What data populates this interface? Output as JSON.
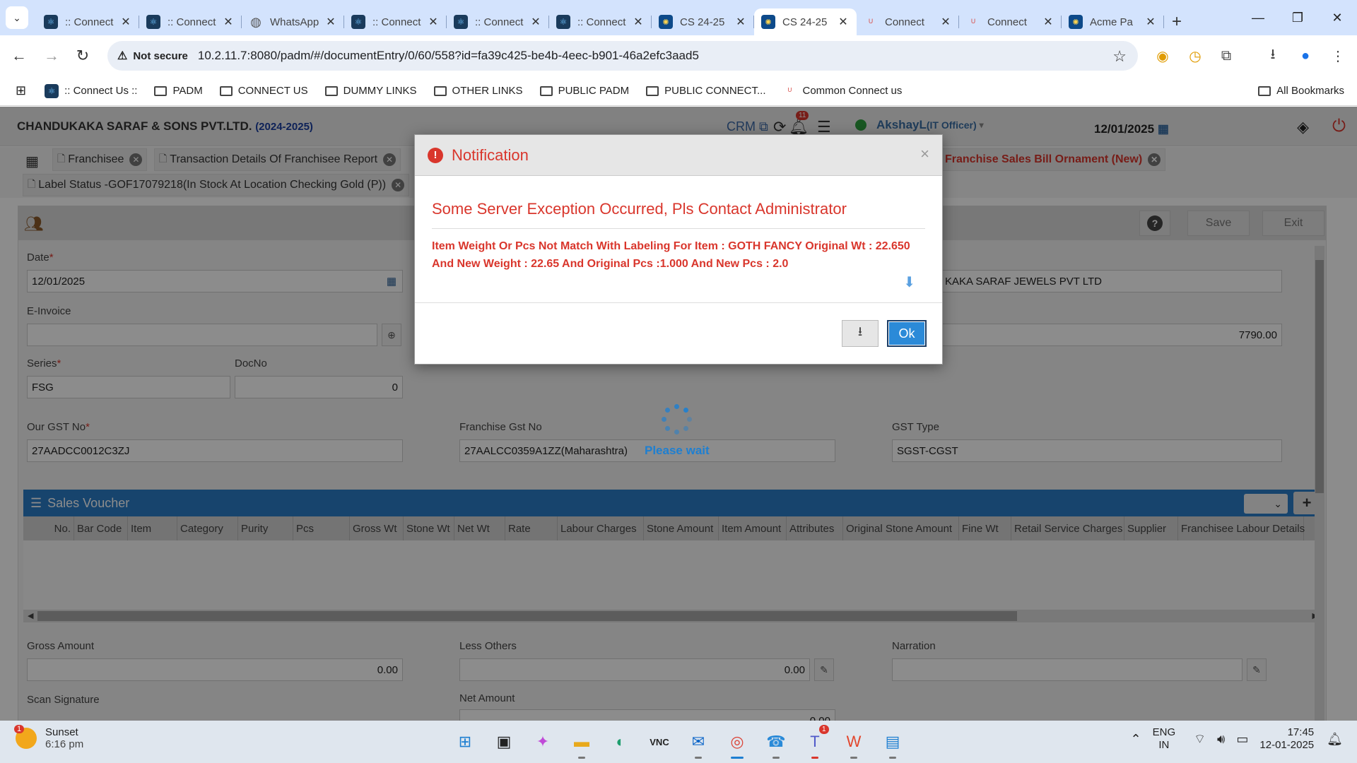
{
  "browser": {
    "tabs": [
      {
        "title": ":: Connect",
        "icon": "react-icon",
        "active": false
      },
      {
        "title": ":: Connect",
        "icon": "react-icon",
        "active": false
      },
      {
        "title": "WhatsApp",
        "icon": "globe-icon",
        "active": false
      },
      {
        "title": ":: Connect",
        "icon": "react-icon",
        "active": false
      },
      {
        "title": ":: Connect",
        "icon": "react-icon",
        "active": false
      },
      {
        "title": ":: Connect",
        "icon": "react-icon",
        "active": false
      },
      {
        "title": "CS 24-25",
        "icon": "cs-icon",
        "active": false
      },
      {
        "title": "CS 24-25",
        "icon": "cs-icon",
        "active": true
      },
      {
        "title": "Connect",
        "icon": "connect-icon",
        "active": false
      },
      {
        "title": "Connect",
        "icon": "connect-icon",
        "active": false
      },
      {
        "title": "Acme Pa",
        "icon": "cs-icon",
        "active": false
      }
    ],
    "security_label": "Not secure",
    "url": "10.2.11.7:8080/padm/#/documentEntry/0/60/558?id=fa39c425-be4b-4eec-b901-46a2efc3aad5",
    "bookmarks": [
      {
        "label": ":: Connect Us ::",
        "type": "site"
      },
      {
        "label": "PADM",
        "type": "folder"
      },
      {
        "label": "CONNECT US",
        "type": "folder"
      },
      {
        "label": "DUMMY LINKS",
        "type": "folder"
      },
      {
        "label": "OTHER LINKS",
        "type": "folder"
      },
      {
        "label": "PUBLIC PADM",
        "type": "folder"
      },
      {
        "label": "PUBLIC CONNECT...",
        "type": "folder"
      },
      {
        "label": "Common Connect us",
        "type": "site"
      }
    ],
    "all_bookmarks": "All Bookmarks"
  },
  "app": {
    "company": "CHANDUKAKA SARAF & SONS PVT.LTD.",
    "year": "(2024-2025)",
    "crm_label": "CRM",
    "notification_count": "11",
    "user_name": "AkshayL",
    "user_role": "(IT Officer)",
    "header_date": "12/01/2025",
    "subtabs": {
      "franchisee": "Franchisee",
      "transaction_report": "Transaction Details Of Franchisee Report",
      "sales_bill": "Franchise Sales Bill Ornament (New)",
      "label_status": "Label Status -GOF17079218(In Stock At Location Checking Gold (P))"
    },
    "buttons": {
      "save": "Save",
      "exit": "Exit"
    },
    "form": {
      "date_label": "Date",
      "date_value": "12/01/2025",
      "einvoice_label": "E-Invoice",
      "einvoice_value": "",
      "series_label": "Series",
      "series_value": "FSG",
      "docno_label": "DocNo",
      "docno_value": "0",
      "party_value": "KAKA SARAF JEWELS PVT LTD",
      "amount_value": "7790.00",
      "our_gst_label": "Our GST No",
      "our_gst_value": "27AADCC0012C3ZJ",
      "franchise_gst_label": "Franchise Gst No",
      "franchise_gst_value": "27AALCC0359A1ZZ(Maharashtra)",
      "gst_type_label": "GST Type",
      "gst_type_value": "SGST-CGST"
    },
    "voucher": {
      "title": "Sales Voucher",
      "columns": [
        "No.",
        "Bar Code",
        "Item",
        "Category",
        "Purity",
        "Pcs",
        "Gross Wt",
        "Stone Wt",
        "Net Wt",
        "Rate",
        "Labour Charges",
        "Stone Amount",
        "Item Amount",
        "Attributes",
        "Original Stone Amount",
        "Fine Wt",
        "Retail Service Charges",
        "Supplier",
        "Franchisee Labour Details"
      ]
    },
    "footer": {
      "gross_label": "Gross Amount",
      "gross_value": "0.00",
      "less_label": "Less Others",
      "less_value": "0.00",
      "narration_label": "Narration",
      "narration_value": "",
      "signature_label": "Scan Signature",
      "net_label": "Net Amount",
      "net_value": "0.00"
    },
    "loading_text": "Please wait"
  },
  "modal": {
    "title": "Notification",
    "error_title": "Some Server Exception Occurred, Pls Contact Administrator",
    "detail": "Item Weight Or Pcs Not Match With Labeling For Item : GOTH FANCY Original Wt : 22.650 And New Weight : 22.65 And Original Pcs :1.000 And New Pcs : 2.0",
    "ok_label": "Ok"
  },
  "taskbar": {
    "weather_title": "Sunset",
    "weather_time": "6:16 pm",
    "weather_badge": "1",
    "teams_badge": "1",
    "lang_top": "ENG",
    "lang_bottom": "IN",
    "time": "17:45",
    "date": "12-01-2025"
  },
  "colors": {
    "accent_blue": "#2b7cc7",
    "error_red": "#d9362c",
    "tab_strip": "#d3e3fd"
  }
}
